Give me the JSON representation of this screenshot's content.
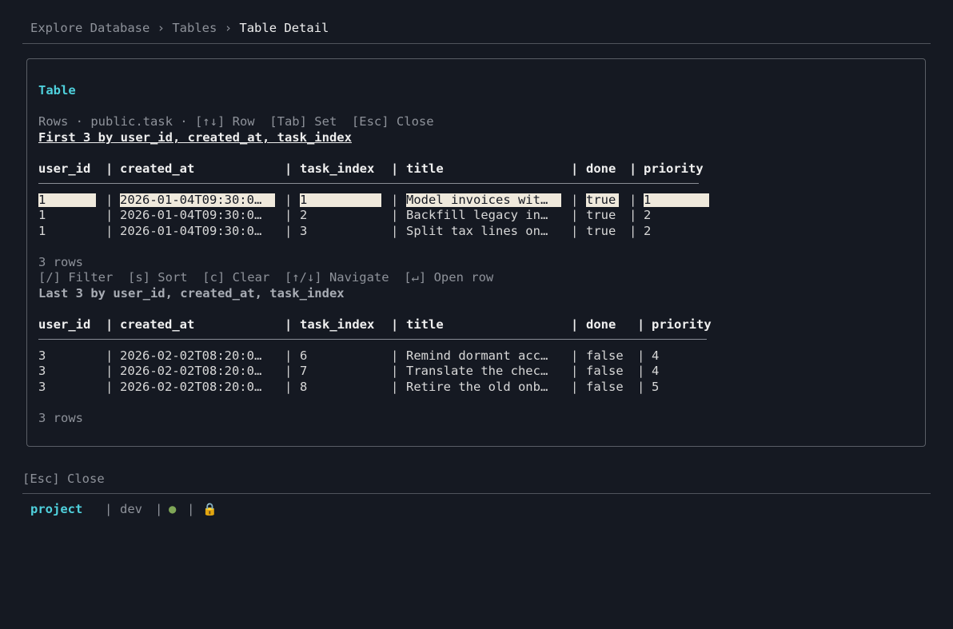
{
  "breadcrumb": {
    "items": [
      "Explore Database",
      "Tables",
      "Table Detail"
    ],
    "separator": "›"
  },
  "panel": {
    "title": "Table",
    "hint": "Rows · public.task · [↑↓] Row  [Tab] Set  [Esc] Close",
    "first": {
      "caption": "First 3 by user_id, created_at, task_index",
      "columns": [
        "user_id",
        "created_at",
        "task_index",
        "title",
        "done",
        "priority"
      ],
      "rows": [
        [
          "1",
          "2026-01-04T09:30:0…",
          "1",
          "Model invoices wit…",
          "true",
          "1"
        ],
        [
          "1",
          "2026-01-04T09:30:0…",
          "2",
          "Backfill legacy in…",
          "true",
          "2"
        ],
        [
          "1",
          "2026-01-04T09:30:0…",
          "3",
          "Split tax lines on…",
          "true",
          "2"
        ]
      ],
      "row_count": "3 rows"
    },
    "keys_hint": "[/] Filter  [s] Sort  [c] Clear  [↑/↓] Navigate  [↵] Open row",
    "last": {
      "caption": "Last 3 by user_id, created_at, task_index",
      "columns": [
        "user_id",
        "created_at",
        "task_index",
        "title",
        "done",
        "priority"
      ],
      "rows": [
        [
          "3",
          "2026-02-02T08:20:0…",
          "6",
          "Remind dormant acc…",
          "false",
          "4"
        ],
        [
          "3",
          "2026-02-02T08:20:0…",
          "7",
          "Translate the chec…",
          "false",
          "4"
        ],
        [
          "3",
          "2026-02-02T08:20:0…",
          "8",
          "Retire the old onb…",
          "false",
          "5"
        ]
      ],
      "row_count": "3 rows"
    }
  },
  "footer_hint": "[Esc] Close",
  "status": {
    "project": "project",
    "env": "dev",
    "dot": "●",
    "lock": "🔒",
    "pipe": "|"
  },
  "colors": {
    "background": "#151922",
    "accent": "#4fd0dc",
    "selection": "#efe9dc",
    "connected": "#7fa657"
  }
}
